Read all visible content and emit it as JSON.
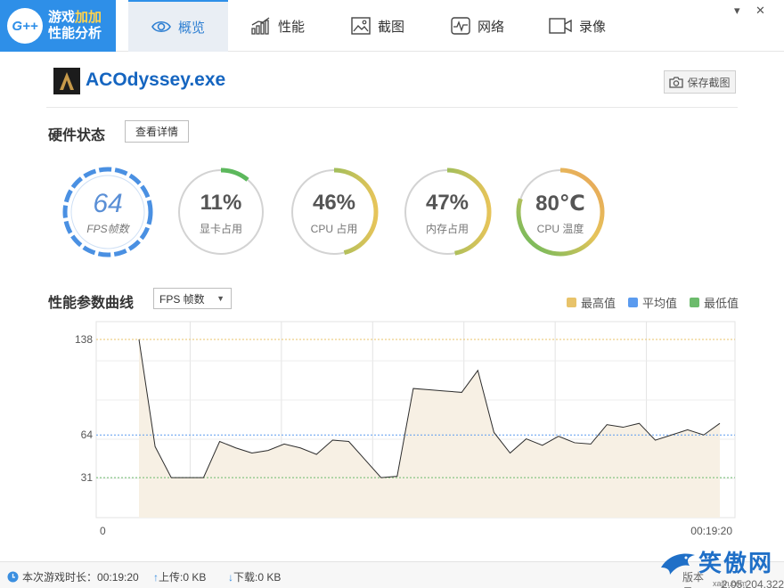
{
  "header": {
    "logo_mark": "G++",
    "logo_line1_a": "游戏",
    "logo_line1_b": "加加",
    "logo_line2": "性能分析",
    "tabs": [
      {
        "label": "概览",
        "icon": "eye-icon",
        "active": true
      },
      {
        "label": "性能",
        "icon": "bar-chart-icon",
        "active": false
      },
      {
        "label": "截图",
        "icon": "image-icon",
        "active": false
      },
      {
        "label": "网络",
        "icon": "pulse-icon",
        "active": false
      },
      {
        "label": "录像",
        "icon": "video-camera-icon",
        "active": false
      }
    ],
    "minimize_symbol": "▾",
    "close_symbol": "✕"
  },
  "app": {
    "name": "ACOdyssey.exe",
    "snapshot_label": "保存截图"
  },
  "hardware": {
    "title": "硬件状态",
    "detail_button": "查看详情",
    "gauges": [
      {
        "id": "fps",
        "value": "64",
        "label": "FPS帧数",
        "fraction": 1.0
      },
      {
        "id": "gpu",
        "value": "11%",
        "label": "显卡占用",
        "fraction": 0.11
      },
      {
        "id": "cpu",
        "value": "46%",
        "label": "CPU 占用",
        "fraction": 0.46
      },
      {
        "id": "mem",
        "value": "47%",
        "label": "内存占用",
        "fraction": 0.47
      },
      {
        "id": "temp",
        "value": "80℃",
        "label": "CPU 温度",
        "fraction": 0.8
      }
    ]
  },
  "curve": {
    "title": "性能参数曲线",
    "selected_metric": "FPS 帧数",
    "legend": [
      {
        "label": "最高值",
        "color": "#e8c36a"
      },
      {
        "label": "平均值",
        "color": "#5b9bef"
      },
      {
        "label": "最低值",
        "color": "#6cbb6c"
      }
    ]
  },
  "chart_data": {
    "type": "area",
    "y_ticks": [
      138,
      64,
      31
    ],
    "x_start_label": "0",
    "x_end_label": "00:19:20",
    "max": 138,
    "avg": 64,
    "min": 31,
    "ylim": [
      0,
      138
    ],
    "values": [
      138,
      55,
      31,
      31,
      31,
      59,
      54,
      50,
      52,
      57,
      54,
      49,
      60,
      59,
      45,
      31,
      32,
      100,
      99,
      98,
      97,
      114,
      66,
      50,
      61,
      56,
      63,
      58,
      57,
      72,
      70,
      73,
      60,
      64,
      68,
      64,
      73
    ],
    "line_color": "#2d2d2d",
    "fill_color": "#f7f0e4"
  },
  "status": {
    "duration_label": "本次游戏时长：",
    "duration_value": "00:19:20",
    "upload_label": "上传: ",
    "upload_value": "0 KB",
    "download_label": "下载: ",
    "download_value": "0 KB",
    "version_label": "版本号：",
    "version_value": "2.05.204.322"
  },
  "watermark": {
    "text": "笑傲网",
    "sub": "xajjn.com"
  }
}
